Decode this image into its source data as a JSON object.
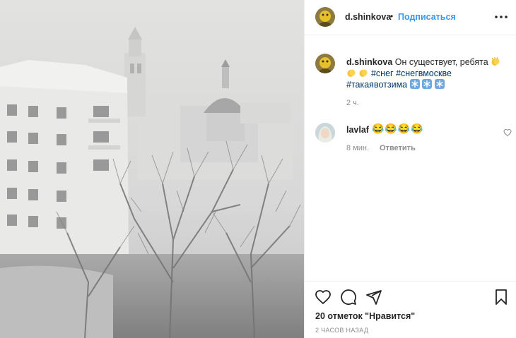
{
  "author": {
    "username": "d.shinkova",
    "follow_label": "Подписаться",
    "separator": "•"
  },
  "icons": {
    "more": "more-options-icon",
    "like": "heart-icon",
    "comment": "comment-icon",
    "share": "paper-plane-icon",
    "save": "bookmark-icon"
  },
  "caption": {
    "username": "d.shinkova",
    "text": "Он существует, ребята",
    "hashtags": [
      "#снег",
      "#снегвмоскве",
      "#такаявотзима"
    ],
    "emojis": [
      "clapping-hands-emoji",
      "snowflake-emoji"
    ],
    "time": "2 ч."
  },
  "comments": [
    {
      "username": "lavlaf",
      "text": "😂😂😂😂",
      "time": "8 мин.",
      "reply_label": "Ответить"
    }
  ],
  "likes_text": "20 отметок \"Нравится\"",
  "posted_ago": "2 ЧАСОВ НАЗАД",
  "colors": {
    "link": "#3897f0",
    "hashtag": "#003569",
    "muted": "#8e8e8e",
    "divider": "#efefef"
  }
}
